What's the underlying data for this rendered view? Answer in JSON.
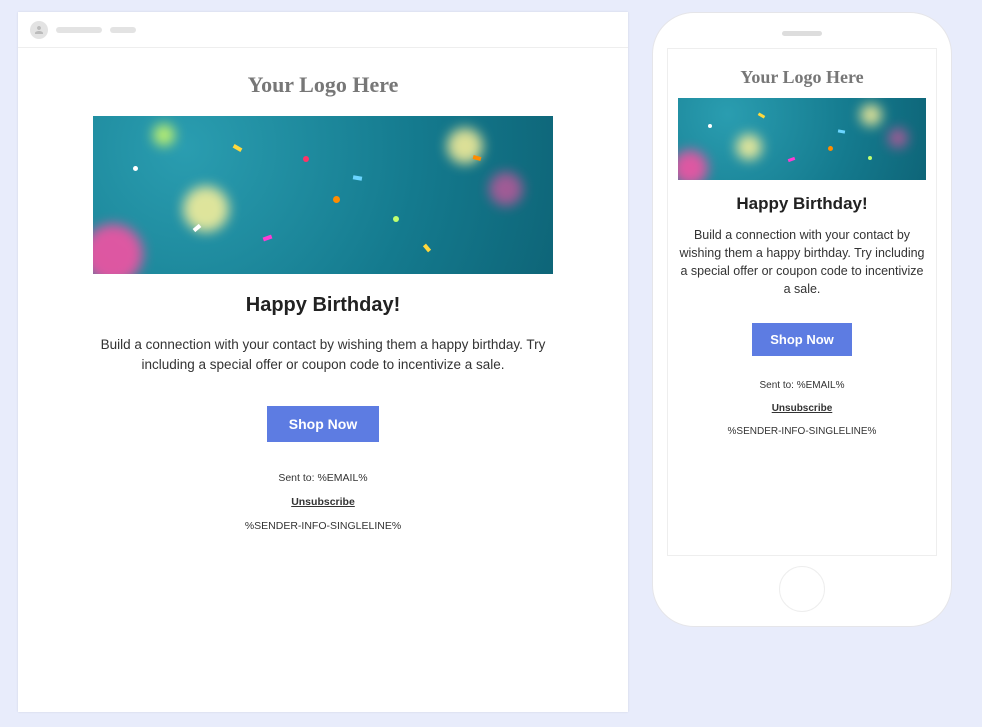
{
  "email": {
    "logo_text": "Your Logo Here",
    "headline": "Happy Birthday!",
    "body": "Build a connection with your contact by wishing them a happy birthday. Try including a special offer or coupon code to incentivize a sale.",
    "cta_label": "Shop Now",
    "footer": {
      "sent_to": "Sent to: %EMAIL%",
      "unsubscribe": "Unsubscribe",
      "sender_info": "%SENDER-INFO-SINGLELINE%"
    }
  }
}
